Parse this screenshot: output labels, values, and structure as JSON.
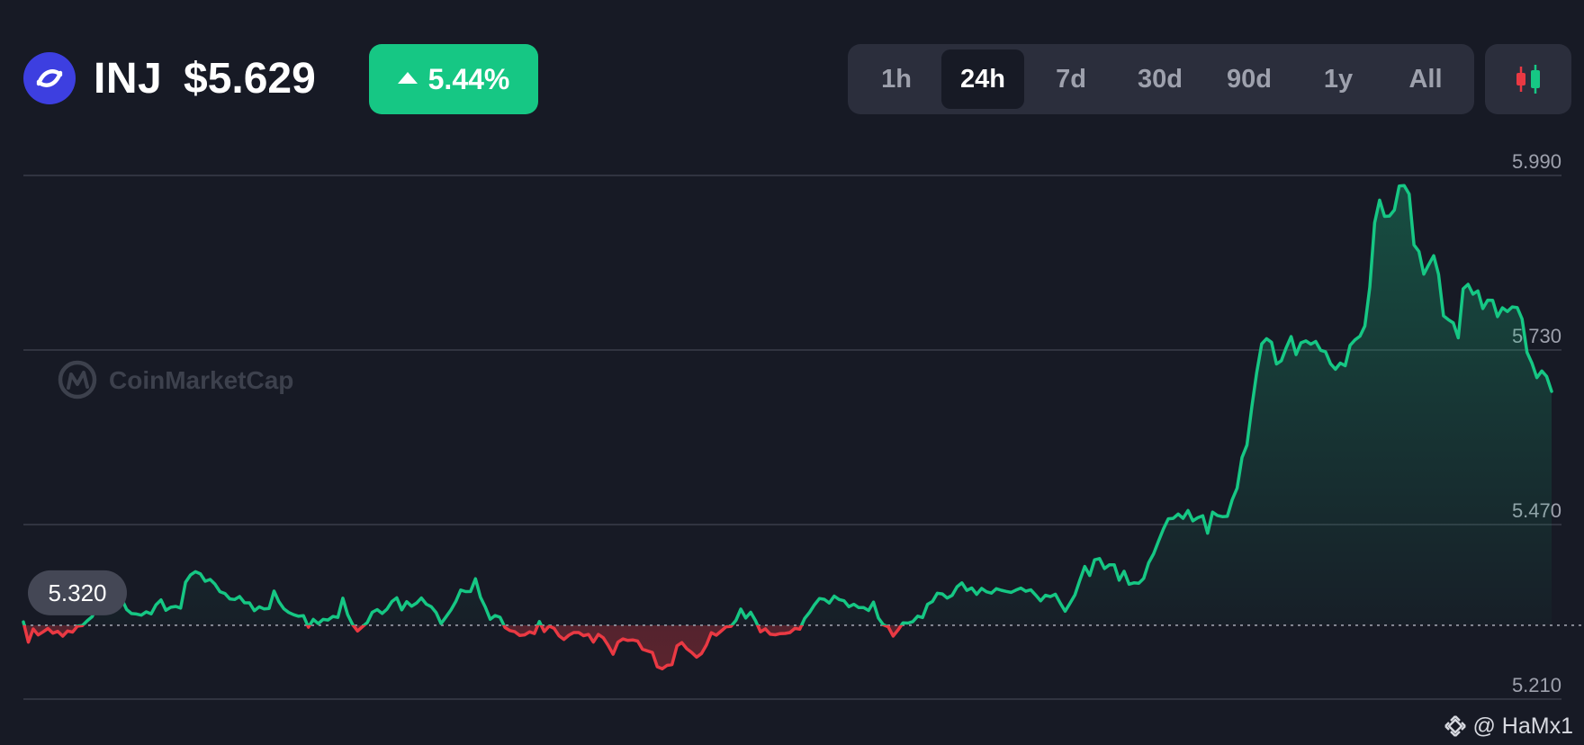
{
  "header": {
    "symbol": "INJ",
    "price": "$5.629",
    "change": "5.44%",
    "change_direction": "up",
    "ranges": [
      "1h",
      "24h",
      "7d",
      "30d",
      "90d",
      "1y",
      "All"
    ],
    "active_range": "24h"
  },
  "watermark": "CoinMarketCap",
  "credit": "@ HaMx1",
  "colors": {
    "background": "#171a25",
    "up": "#16c784",
    "down": "#ea3943",
    "logo": "#3d3fe0",
    "panel": "#2b2e3c"
  },
  "icons": {
    "logo": "injective-logo-icon",
    "change": "triangle-up-icon",
    "chart_type": "candlestick-icon",
    "credit": "binance-diamond-icon"
  },
  "chart_data": {
    "type": "line",
    "title": "",
    "xlabel": "",
    "ylabel": "",
    "ylim": [
      5.19,
      6.005
    ],
    "yticks": [
      "5.990",
      "5.730",
      "5.470",
      "5.210"
    ],
    "grid": true,
    "baseline": 5.32,
    "baseline_label": "5.320",
    "baseline_style": "dotted",
    "fill": "gradient-under-line",
    "colors_above_below": [
      "#16c784",
      "#ea3943"
    ],
    "points": 248,
    "y": [
      5.325,
      5.2949,
      5.3145,
      5.3056,
      5.3101,
      5.3152,
      5.3082,
      5.3109,
      5.3038,
      5.3114,
      5.3098,
      5.3187,
      5.3195,
      5.3267,
      5.3328,
      5.348,
      5.3548,
      5.3557,
      5.3556,
      5.3539,
      5.3593,
      5.3435,
      5.3375,
      5.3368,
      5.3351,
      5.34,
      5.3371,
      5.3506,
      5.3578,
      5.3423,
      5.3468,
      5.348,
      5.3456,
      5.3841,
      5.3948,
      5.3998,
      5.3967,
      5.3855,
      5.3882,
      5.3811,
      5.37,
      5.3673,
      5.3593,
      5.3584,
      5.3628,
      5.3535,
      5.3534,
      5.3418,
      5.3475,
      5.3443,
      5.3451,
      5.3709,
      5.355,
      5.3446,
      5.3391,
      5.3357,
      5.3335,
      5.3342,
      5.3171,
      5.3287,
      5.3225,
      5.3288,
      5.3278,
      5.3332,
      5.3317,
      5.3604,
      5.3358,
      5.321,
      5.3114,
      5.3178,
      5.3242,
      5.3393,
      5.3434,
      5.3376,
      5.3441,
      5.3554,
      5.3609,
      5.3429,
      5.3552,
      5.3485,
      5.353,
      5.3606,
      5.3514,
      5.3477,
      5.3388,
      5.3225,
      5.3324,
      5.3427,
      5.3555,
      5.3725,
      5.3701,
      5.3703,
      5.3893,
      5.362,
      5.3473,
      5.3289,
      5.3345,
      5.3319,
      5.3167,
      5.3121,
      5.3104,
      5.3049,
      5.3057,
      5.3102,
      5.3077,
      5.3255,
      5.3107,
      5.3188,
      5.3153,
      5.3043,
      5.2988,
      5.3051,
      5.3092,
      5.3092,
      5.3045,
      5.3063,
      5.295,
      5.3064,
      5.3014,
      5.2901,
      5.2769,
      5.2948,
      5.2996,
      5.2974,
      5.2982,
      5.2965,
      5.2842,
      5.2819,
      5.2794,
      5.2583,
      5.2551,
      5.2603,
      5.2615,
      5.2893,
      5.2942,
      5.285,
      5.2796,
      5.2725,
      5.2779,
      5.2906,
      5.3089,
      5.3052,
      5.3113,
      5.3177,
      5.3184,
      5.3273,
      5.344,
      5.3308,
      5.3393,
      5.3267,
      5.3103,
      5.3147,
      5.3066,
      5.3058,
      5.3076,
      5.3078,
      5.3092,
      5.3154,
      5.3141,
      5.3302,
      5.3393,
      5.3506,
      5.3599,
      5.3586,
      5.3531,
      5.3635,
      5.3583,
      5.3565,
      5.3476,
      5.3512,
      5.3463,
      5.3465,
      5.342,
      5.3545,
      5.3308,
      5.3207,
      5.3177,
      5.304,
      5.3129,
      5.3237,
      5.3232,
      5.3254,
      5.3336,
      5.3316,
      5.3512,
      5.3554,
      5.3678,
      5.3667,
      5.3605,
      5.3645,
      5.3774,
      5.3831,
      5.3719,
      5.3755,
      5.3662,
      5.3749,
      5.3699,
      5.3679,
      5.3745,
      5.3722,
      5.3704,
      5.3689,
      5.3725,
      5.3754,
      5.3707,
      5.3728,
      5.365,
      5.3564,
      5.3647,
      5.3626,
      5.3663,
      5.3532,
      5.3409,
      5.3527,
      5.3653,
      5.3875,
      5.4076,
      5.3941,
      5.4174,
      5.4193,
      5.4045,
      5.41,
      5.4099,
      5.3872,
      5.4004,
      5.3811,
      5.3831,
      5.3826,
      5.3899,
      5.413,
      5.4264,
      5.4452,
      5.4634,
      5.4786,
      5.4793,
      5.4857,
      5.4792,
      5.4909,
      5.4755,
      5.4802,
      5.4832,
      5.4571,
      5.4885,
      5.4836,
      5.4818,
      5.4822,
      5.5068,
      5.5243,
      5.5699,
      5.5883,
      5.646,
      5.6968,
      5.7391,
      5.7469,
      5.7415,
      5.7092,
      5.7141,
      5.7336,
      5.75,
      5.7231,
      5.7407,
      5.7436,
      5.7387,
      5.7427,
      5.7296,
      5.7274,
      5.7097,
      5.7013,
      5.7105,
      5.7067,
      5.737,
      5.7452,
      5.7507,
      5.7657,
      5.8235,
      5.9197,
      5.9533,
      5.929,
      5.9295,
      5.9386,
      5.9743,
      5.9749,
      5.9624,
      5.8865,
      5.8768,
      5.843,
      5.8572,
      5.8705,
      5.8427,
      5.7809,
      5.7751,
      5.7703,
      5.7481,
      5.8211,
      5.8279,
      5.8132,
      5.818,
      5.7918,
      5.8042,
      5.8041,
      5.7797,
      5.7928,
      5.7873,
      5.7942,
      5.7932,
      5.7763,
      5.7265,
      5.7103,
      5.6889,
      5.6988,
      5.6906,
      5.6684
    ],
    "start_value": 5.325,
    "end_value": 5.668,
    "min_value": 5.255,
    "max_value": 5.975
  }
}
